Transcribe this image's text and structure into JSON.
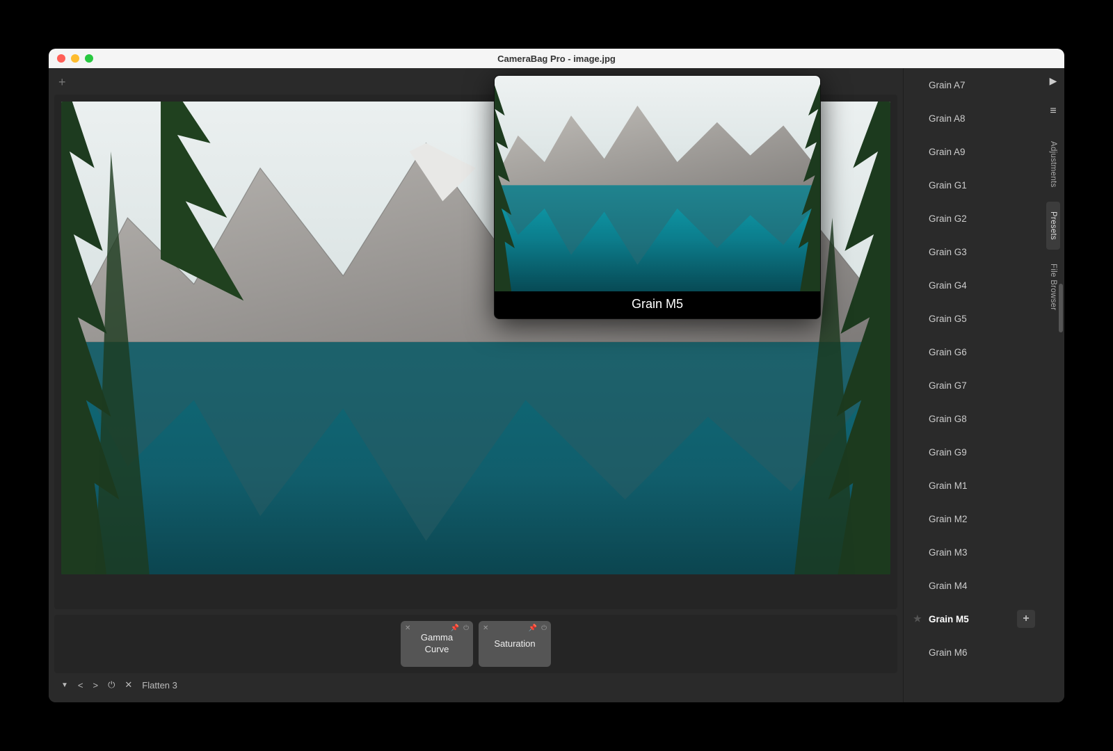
{
  "window": {
    "title": "CameraBag Pro - image.jpg"
  },
  "preview": {
    "label": "Grain M5"
  },
  "filters": {
    "chip1": "Gamma\nCurve",
    "chip2": "Saturation"
  },
  "bottombar": {
    "label": "Flatten 3"
  },
  "presets": {
    "items": [
      "Grain A7",
      "Grain A8",
      "Grain A9",
      "Grain G1",
      "Grain G2",
      "Grain G3",
      "Grain G4",
      "Grain G5",
      "Grain G6",
      "Grain G7",
      "Grain G8",
      "Grain G9",
      "Grain M1",
      "Grain M2",
      "Grain M3",
      "Grain M4",
      "Grain M5",
      "Grain M6"
    ],
    "selected": "Grain M5"
  },
  "sidetabs": {
    "adjustments": "Adjustments",
    "presets": "Presets",
    "filebrowser": "File Browser"
  }
}
